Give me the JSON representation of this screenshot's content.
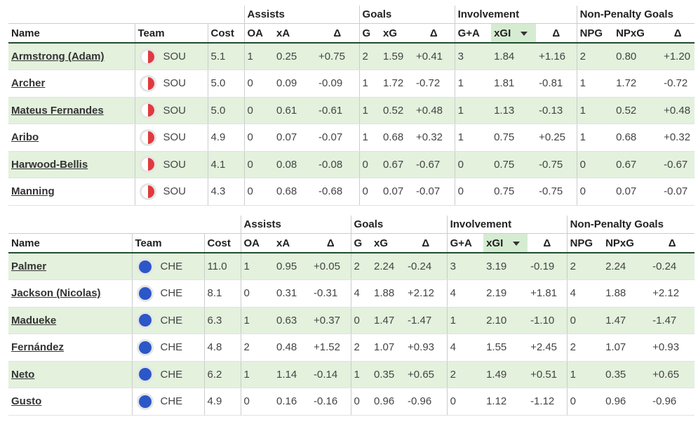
{
  "headers": {
    "group_assists": "Assists",
    "group_goals": "Goals",
    "group_involvement": "Involvement",
    "group_npg": "Non-Penalty Goals",
    "name": "Name",
    "team": "Team",
    "cost": "Cost",
    "oa": "OA",
    "xa": "xA",
    "delta": "Δ",
    "g": "G",
    "xg": "xG",
    "ga": "G+A",
    "xgi": "xGI",
    "npg": "NPG",
    "npxg": "NPxG"
  },
  "tables": [
    {
      "rows": [
        {
          "name": "Armstrong (Adam)",
          "team": "SOU",
          "cost": "5.1",
          "oa": "1",
          "xa": "0.25",
          "da": "+0.75",
          "g": "2",
          "xg": "1.59",
          "dg": "+0.41",
          "ga": "3",
          "xgi": "1.84",
          "di": "+1.16",
          "npg": "2",
          "npxg": "0.80",
          "dn": "+1.20"
        },
        {
          "name": "Archer",
          "team": "SOU",
          "cost": "5.0",
          "oa": "0",
          "xa": "0.09",
          "da": "-0.09",
          "g": "1",
          "xg": "1.72",
          "dg": "-0.72",
          "ga": "1",
          "xgi": "1.81",
          "di": "-0.81",
          "npg": "1",
          "npxg": "1.72",
          "dn": "-0.72"
        },
        {
          "name": "Mateus Fernandes",
          "team": "SOU",
          "cost": "5.0",
          "oa": "0",
          "xa": "0.61",
          "da": "-0.61",
          "g": "1",
          "xg": "0.52",
          "dg": "+0.48",
          "ga": "1",
          "xgi": "1.13",
          "di": "-0.13",
          "npg": "1",
          "npxg": "0.52",
          "dn": "+0.48"
        },
        {
          "name": "Aribo",
          "team": "SOU",
          "cost": "4.9",
          "oa": "0",
          "xa": "0.07",
          "da": "-0.07",
          "g": "1",
          "xg": "0.68",
          "dg": "+0.32",
          "ga": "1",
          "xgi": "0.75",
          "di": "+0.25",
          "npg": "1",
          "npxg": "0.68",
          "dn": "+0.32"
        },
        {
          "name": "Harwood-Bellis",
          "team": "SOU",
          "cost": "4.1",
          "oa": "0",
          "xa": "0.08",
          "da": "-0.08",
          "g": "0",
          "xg": "0.67",
          "dg": "-0.67",
          "ga": "0",
          "xgi": "0.75",
          "di": "-0.75",
          "npg": "0",
          "npxg": "0.67",
          "dn": "-0.67"
        },
        {
          "name": "Manning",
          "team": "SOU",
          "cost": "4.3",
          "oa": "0",
          "xa": "0.68",
          "da": "-0.68",
          "g": "0",
          "xg": "0.07",
          "dg": "-0.07",
          "ga": "0",
          "xgi": "0.75",
          "di": "-0.75",
          "npg": "0",
          "npxg": "0.07",
          "dn": "-0.07"
        }
      ]
    },
    {
      "rows": [
        {
          "name": "Palmer",
          "team": "CHE",
          "cost": "11.0",
          "oa": "1",
          "xa": "0.95",
          "da": "+0.05",
          "g": "2",
          "xg": "2.24",
          "dg": "-0.24",
          "ga": "3",
          "xgi": "3.19",
          "di": "-0.19",
          "npg": "2",
          "npxg": "2.24",
          "dn": "-0.24"
        },
        {
          "name": "Jackson (Nicolas)",
          "team": "CHE",
          "cost": "8.1",
          "oa": "0",
          "xa": "0.31",
          "da": "-0.31",
          "g": "4",
          "xg": "1.88",
          "dg": "+2.12",
          "ga": "4",
          "xgi": "2.19",
          "di": "+1.81",
          "npg": "4",
          "npxg": "1.88",
          "dn": "+2.12"
        },
        {
          "name": "Madueke",
          "team": "CHE",
          "cost": "6.3",
          "oa": "1",
          "xa": "0.63",
          "da": "+0.37",
          "g": "0",
          "xg": "1.47",
          "dg": "-1.47",
          "ga": "1",
          "xgi": "2.10",
          "di": "-1.10",
          "npg": "0",
          "npxg": "1.47",
          "dn": "-1.47"
        },
        {
          "name": "Fernández",
          "team": "CHE",
          "cost": "4.8",
          "oa": "2",
          "xa": "0.48",
          "da": "+1.52",
          "g": "2",
          "xg": "1.07",
          "dg": "+0.93",
          "ga": "4",
          "xgi": "1.55",
          "di": "+2.45",
          "npg": "2",
          "npxg": "1.07",
          "dn": "+0.93"
        },
        {
          "name": "Neto",
          "team": "CHE",
          "cost": "6.2",
          "oa": "1",
          "xa": "1.14",
          "da": "-0.14",
          "g": "1",
          "xg": "0.35",
          "dg": "+0.65",
          "ga": "2",
          "xgi": "1.49",
          "di": "+0.51",
          "npg": "1",
          "npxg": "0.35",
          "dn": "+0.65"
        },
        {
          "name": "Gusto",
          "team": "CHE",
          "cost": "4.9",
          "oa": "0",
          "xa": "0.16",
          "da": "-0.16",
          "g": "0",
          "xg": "0.96",
          "dg": "-0.96",
          "ga": "0",
          "xgi": "1.12",
          "di": "-1.12",
          "npg": "0",
          "npxg": "0.96",
          "dn": "-0.96"
        }
      ]
    }
  ],
  "team_icons": {
    "SOU": "southampton-crest-icon",
    "CHE": "chelsea-crest-icon"
  },
  "colors": {
    "row_alt": "#e3f1dd",
    "sorted_header": "#d6ecd2",
    "header_rule": "#1f4e2c",
    "sou_red": "#e03a3e",
    "che_blue": "#2b57c8"
  }
}
